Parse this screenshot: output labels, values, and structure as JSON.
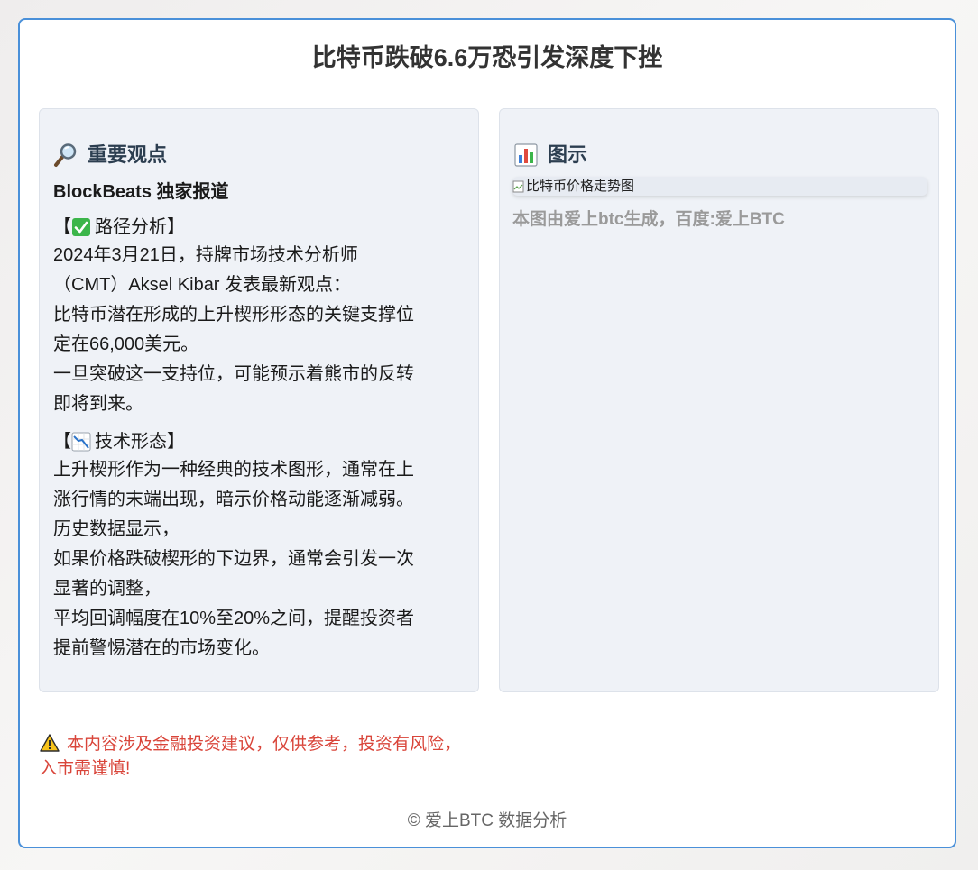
{
  "page": {
    "title": "比特币跌破6.6万恐引发深度下挫"
  },
  "left_panel": {
    "icon": "magnifier-icon",
    "heading": "重要观点",
    "subtitle": "BlockBeats 独家报道",
    "section1": {
      "icon": "check-mark-icon",
      "open": "【",
      "label": "路径分析】",
      "lines": [
        "2024年3月21日，持牌市场技术分析师",
        "（CMT）Aksel Kibar 发表最新观点：",
        "比特币潜在形成的上升楔形形态的关键支撑位",
        "定在66,000美元。",
        "一旦突破这一支持位，可能预示着熊市的反转",
        "即将到来。"
      ]
    },
    "section2": {
      "icon": "chart-decreasing-icon",
      "open": "【",
      "label": "技术形态】",
      "lines": [
        "上升楔形作为一种经典的技术图形，通常在上",
        "涨行情的末端出现，暗示价格动能逐渐减弱。",
        "历史数据显示，",
        "如果价格跌破楔形的下边界，通常会引发一次",
        "显著的调整，",
        "平均回调幅度在10%至20%之间，提醒投资者",
        "提前警惕潜在的市场变化。"
      ]
    }
  },
  "right_panel": {
    "icon": "bar-chart-icon",
    "heading": "图示",
    "image_alt": "比特币价格走势图",
    "caption": "本图由爱上btc生成，百度:爱上BTC"
  },
  "warning": {
    "icon": "warning-icon",
    "text": "本内容涉及金融投资建议，仅供参考，投资有风险，入市需谨慎!"
  },
  "footer": {
    "text": "© 爱上BTC 数据分析"
  },
  "colors": {
    "border": "#4a90d9",
    "panel_bg": "#eff2f7",
    "warning": "#d9453a",
    "caption": "#9a9a9a"
  }
}
